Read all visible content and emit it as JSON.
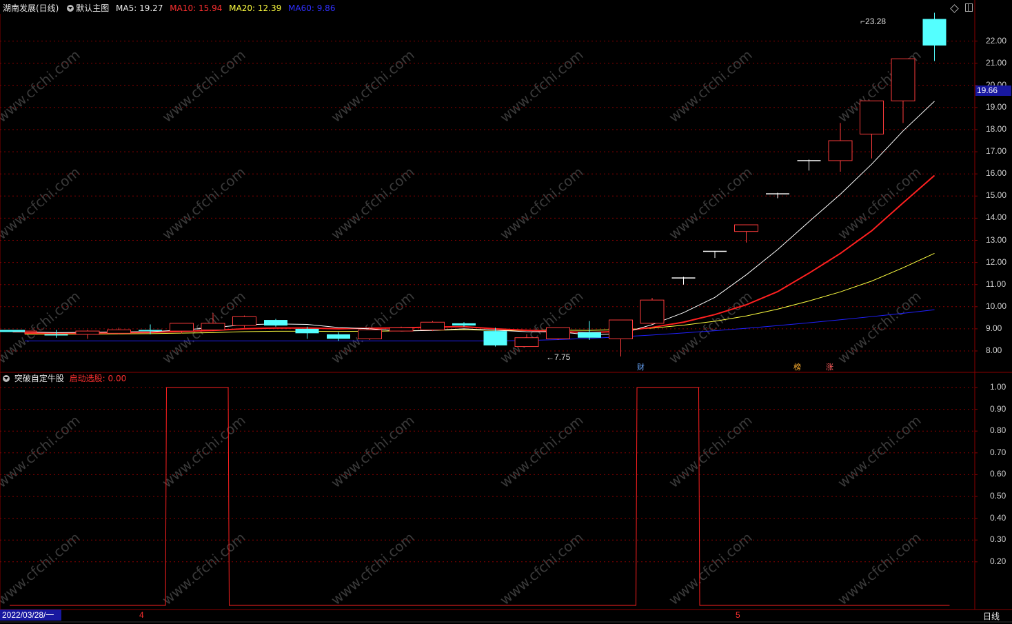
{
  "header": {
    "stock_title": "湖南发展(日线)",
    "chart_mode": "默认主图",
    "ma5": "MA5: 19.27",
    "ma10": "MA10: 15.94",
    "ma20": "MA20: 12.39",
    "ma60": "MA60: 9.86"
  },
  "indicator": {
    "name": "突破自定牛股",
    "value_label": "启动选股: 0.00"
  },
  "price_axis": {
    "ticks": [
      "22.00",
      "21.00",
      "20.00",
      "19.00",
      "18.00",
      "17.00",
      "16.00",
      "15.00",
      "14.00",
      "13.00",
      "12.00",
      "11.00",
      "10.00",
      "9.00",
      "8.00"
    ],
    "current_price": "19.66"
  },
  "indicator_axis": {
    "ticks": [
      "1.00",
      "0.90",
      "0.80",
      "0.70",
      "0.60",
      "0.50",
      "0.40",
      "0.30",
      "0.20"
    ]
  },
  "annotations": {
    "high_label": "23.28",
    "low_label": "7.75"
  },
  "event_markers": {
    "cai": "财",
    "bang": "榜",
    "zhang": "涨"
  },
  "time_axis": {
    "date_label": "2022/03/28/一",
    "month_4": "4",
    "month_5": "5"
  },
  "period_label": "日线",
  "watermark_text": "www.cfchi.com",
  "colors": {
    "up": "#ff3c3c",
    "down": "#54ffff",
    "ma5": "#ffffff",
    "ma10": "#ff2020",
    "ma20": "#ffff40",
    "ma60": "#2020ff",
    "grid": "#8b0000"
  },
  "chart_data": {
    "type": "candlestick",
    "series": [
      {
        "name": "K",
        "ohlc": [
          [
            8.85,
            8.95,
            8.75,
            8.9
          ],
          [
            8.75,
            8.95,
            8.6,
            8.7
          ],
          [
            8.75,
            8.95,
            8.55,
            8.9
          ],
          [
            8.8,
            9.05,
            8.75,
            8.95
          ],
          [
            8.95,
            9.2,
            8.75,
            8.92
          ],
          [
            8.9,
            9.25,
            8.8,
            9.25
          ],
          [
            8.95,
            9.7,
            8.9,
            9.25
          ],
          [
            9.15,
            9.6,
            9.05,
            9.55
          ],
          [
            9.4,
            9.45,
            9.1,
            9.15
          ],
          [
            9.0,
            9.1,
            8.55,
            8.8
          ],
          [
            8.75,
            8.85,
            8.45,
            8.55
          ],
          [
            8.55,
            9.05,
            8.5,
            8.95
          ],
          [
            8.9,
            9.1,
            8.9,
            9.05
          ],
          [
            8.95,
            9.35,
            8.9,
            9.3
          ],
          [
            9.25,
            9.3,
            9.1,
            9.15
          ],
          [
            8.9,
            9.05,
            8.2,
            8.25
          ],
          [
            8.2,
            8.75,
            8.2,
            8.6
          ],
          [
            8.55,
            9.05,
            8.5,
            9.05
          ],
          [
            8.85,
            9.35,
            8.5,
            8.6
          ],
          [
            8.55,
            9.4,
            7.75,
            9.4
          ],
          [
            9.25,
            10.4,
            9.2,
            10.3
          ],
          [
            11.3,
            11.35,
            11.0,
            11.3
          ],
          [
            12.5,
            12.5,
            12.2,
            12.5
          ],
          [
            13.4,
            13.7,
            12.9,
            13.7
          ],
          [
            15.1,
            15.15,
            14.9,
            15.1
          ],
          [
            16.6,
            16.65,
            16.15,
            16.6
          ],
          [
            16.6,
            18.3,
            16.1,
            17.5
          ],
          [
            17.8,
            19.3,
            16.7,
            19.3
          ],
          [
            19.3,
            21.2,
            18.3,
            21.2
          ],
          [
            23.0,
            23.28,
            21.1,
            21.8
          ]
        ]
      },
      {
        "name": "MA5",
        "values": []
      },
      {
        "name": "MA10",
        "values": []
      },
      {
        "name": "MA20",
        "values": []
      },
      {
        "name": "MA60",
        "values": []
      }
    ],
    "indicator_values": [
      0,
      0,
      0,
      0,
      0,
      1,
      1,
      0,
      0,
      0,
      0,
      0,
      0,
      0,
      0,
      0,
      0,
      0,
      0,
      0,
      1,
      1,
      0,
      0,
      0,
      0,
      0,
      0,
      0,
      0
    ],
    "ylim": [
      7.4,
      23.6
    ],
    "indicator_ylim": [
      0,
      1
    ]
  }
}
